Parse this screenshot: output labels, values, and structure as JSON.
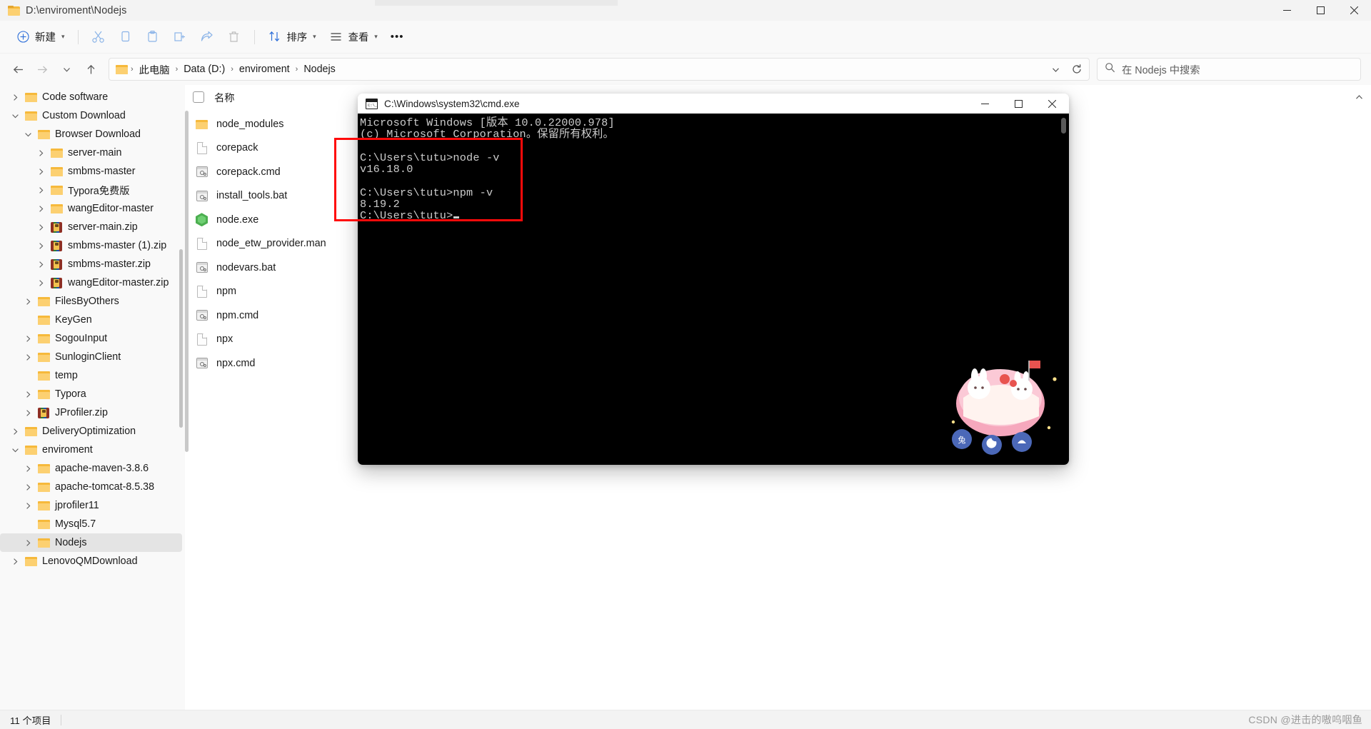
{
  "window": {
    "title": "D:\\enviroment\\Nodejs",
    "minimize_label": "–",
    "maximize_label": "❐",
    "close_label": "✕"
  },
  "toolbar": {
    "new_label": "新建",
    "cut_label": "剪切",
    "copy_label": "复制",
    "paste_label": "粘贴",
    "rename_label": "重命名",
    "share_label": "共享",
    "delete_label": "删除",
    "sort_label": "排序",
    "view_label": "查看",
    "more_label": "•••"
  },
  "nav": {
    "back_label": "←",
    "forward_label": "→",
    "recent_label": "⌄",
    "up_label": "↑",
    "refresh_label": "↻",
    "dropdown_label": "⌄",
    "breadcrumbs": [
      {
        "label": "此电脑"
      },
      {
        "label": "Data (D:)"
      },
      {
        "label": "enviroment"
      },
      {
        "label": "Nodejs"
      }
    ],
    "separator": "›"
  },
  "search": {
    "placeholder": "在 Nodejs 中搜索",
    "icon": "search-icon"
  },
  "sidebar": {
    "items": [
      {
        "label": "Code software",
        "indent": 1,
        "twisty": "collapsed",
        "icon": "folder"
      },
      {
        "label": "Custom Download",
        "indent": 1,
        "twisty": "expanded",
        "icon": "folder"
      },
      {
        "label": "Browser Download",
        "indent": 2,
        "twisty": "expanded",
        "icon": "folder"
      },
      {
        "label": "server-main",
        "indent": 3,
        "twisty": "collapsed",
        "icon": "folder"
      },
      {
        "label": "smbms-master",
        "indent": 3,
        "twisty": "collapsed",
        "icon": "folder"
      },
      {
        "label": "Typora免费版",
        "indent": 3,
        "twisty": "collapsed",
        "icon": "folder"
      },
      {
        "label": "wangEditor-master",
        "indent": 3,
        "twisty": "collapsed",
        "icon": "folder"
      },
      {
        "label": "server-main.zip",
        "indent": 3,
        "twisty": "collapsed",
        "icon": "zip"
      },
      {
        "label": "smbms-master (1).zip",
        "indent": 3,
        "twisty": "collapsed",
        "icon": "zip"
      },
      {
        "label": "smbms-master.zip",
        "indent": 3,
        "twisty": "collapsed",
        "icon": "zip"
      },
      {
        "label": "wangEditor-master.zip",
        "indent": 3,
        "twisty": "collapsed",
        "icon": "zip"
      },
      {
        "label": "FilesByOthers",
        "indent": 2,
        "twisty": "collapsed",
        "icon": "folder"
      },
      {
        "label": "KeyGen",
        "indent": 2,
        "twisty": "none",
        "icon": "folder"
      },
      {
        "label": "SogouInput",
        "indent": 2,
        "twisty": "collapsed",
        "icon": "folder"
      },
      {
        "label": "SunloginClient",
        "indent": 2,
        "twisty": "collapsed",
        "icon": "folder"
      },
      {
        "label": "temp",
        "indent": 2,
        "twisty": "none",
        "icon": "folder"
      },
      {
        "label": "Typora",
        "indent": 2,
        "twisty": "collapsed",
        "icon": "folder"
      },
      {
        "label": "JProfiler.zip",
        "indent": 2,
        "twisty": "collapsed",
        "icon": "zip"
      },
      {
        "label": "DeliveryOptimization",
        "indent": 1,
        "twisty": "collapsed",
        "icon": "folder"
      },
      {
        "label": "enviroment",
        "indent": 1,
        "twisty": "expanded",
        "icon": "folder"
      },
      {
        "label": "apache-maven-3.8.6",
        "indent": 2,
        "twisty": "collapsed",
        "icon": "folder"
      },
      {
        "label": "apache-tomcat-8.5.38",
        "indent": 2,
        "twisty": "collapsed",
        "icon": "folder"
      },
      {
        "label": "jprofiler11",
        "indent": 2,
        "twisty": "collapsed",
        "icon": "folder"
      },
      {
        "label": "Mysql5.7",
        "indent": 2,
        "twisty": "none",
        "icon": "folder"
      },
      {
        "label": "Nodejs",
        "indent": 2,
        "twisty": "collapsed",
        "icon": "folder",
        "selected": true
      },
      {
        "label": "LenovoQMDownload",
        "indent": 1,
        "twisty": "collapsed",
        "icon": "folder"
      }
    ]
  },
  "filepane": {
    "column_header": "名称",
    "files": [
      {
        "name": "node_modules",
        "icon": "folder"
      },
      {
        "name": "corepack",
        "icon": "doc"
      },
      {
        "name": "corepack.cmd",
        "icon": "bat"
      },
      {
        "name": "install_tools.bat",
        "icon": "bat"
      },
      {
        "name": "node.exe",
        "icon": "node"
      },
      {
        "name": "node_etw_provider.man",
        "icon": "doc"
      },
      {
        "name": "nodevars.bat",
        "icon": "bat"
      },
      {
        "name": "npm",
        "icon": "doc"
      },
      {
        "name": "npm.cmd",
        "icon": "bat"
      },
      {
        "name": "npx",
        "icon": "doc"
      },
      {
        "name": "npx.cmd",
        "icon": "bat"
      }
    ]
  },
  "statusbar": {
    "item_count": "11 个项目"
  },
  "cmd": {
    "title": "C:\\Windows\\system32\\cmd.exe",
    "minimize_label": "–",
    "maximize_label": "❐",
    "close_label": "✕",
    "lines": [
      "Microsoft Windows [版本 10.0.22000.978]",
      "(c) Microsoft Corporation。保留所有权利。",
      "",
      "C:\\Users\\tutu>node -v",
      "v16.18.0",
      "",
      "C:\\Users\\tutu>npm -v",
      "8.19.2",
      ""
    ],
    "prompt": "C:\\Users\\tutu>"
  },
  "annotation": {
    "highlight_color": "#ff0a0a"
  },
  "watermark": {
    "text": "CSDN @进击的嗷呜咽鱼"
  }
}
